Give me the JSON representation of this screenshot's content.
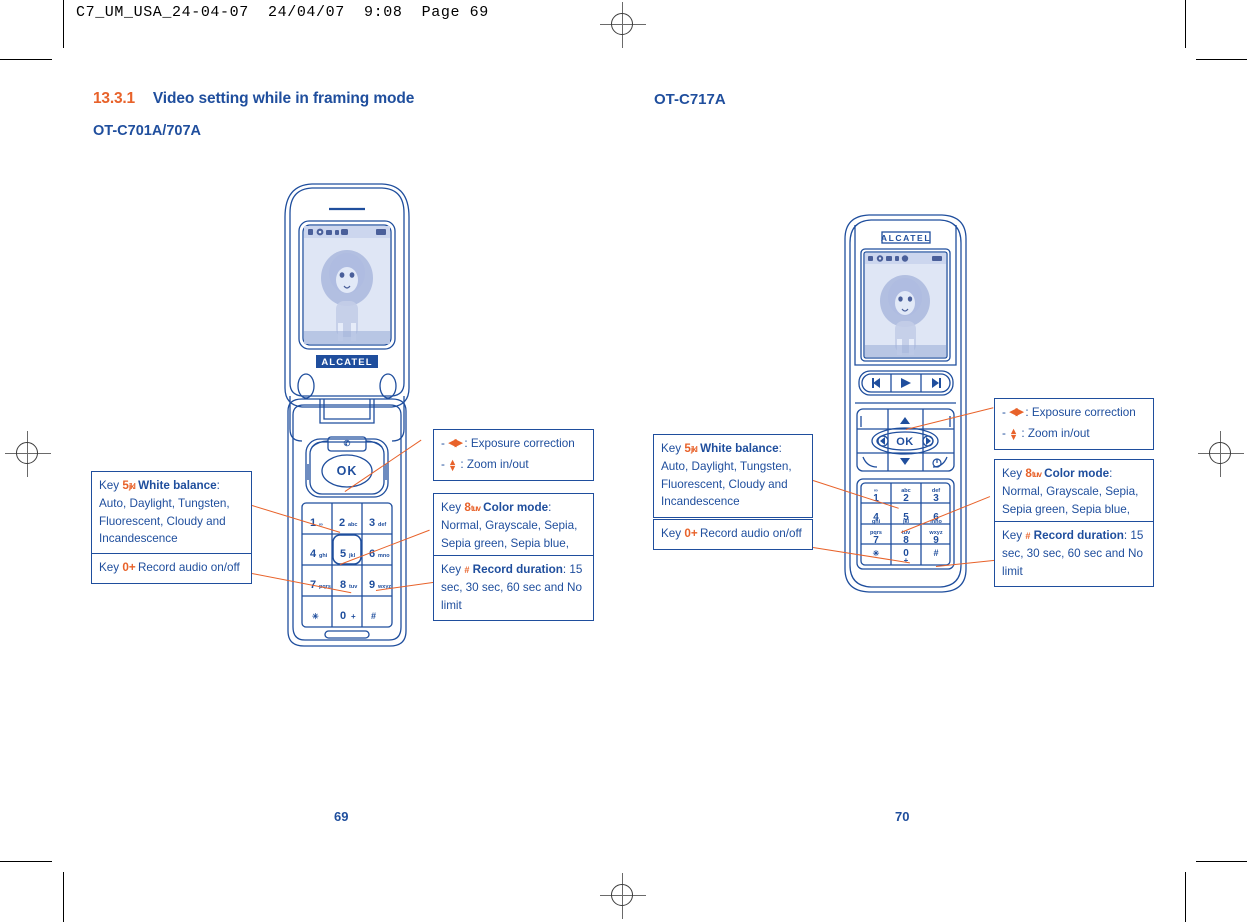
{
  "document": {
    "slug": "C7_UM_USA_24-04-07  24/04/07  9:08  Page 69",
    "colors": {
      "blue": "#1F4E9D",
      "orange": "#E8622A",
      "black": "#000000"
    }
  },
  "left_page": {
    "number": "69",
    "heading": {
      "number": "13.3.1",
      "title": "Video setting while in framing mode"
    },
    "subheading": "OT-C701A/707A",
    "phone": {
      "model": "OT-C701A/707A",
      "brand": "ALCATEL",
      "screen_subject": "lion photo",
      "ok_key": "OK",
      "keys": [
        {
          "digit": "1",
          "letters": ""
        },
        {
          "digit": "2",
          "letters": "abc"
        },
        {
          "digit": "3",
          "letters": "def"
        },
        {
          "digit": "4",
          "letters": "ghi"
        },
        {
          "digit": "5",
          "letters": "jkl"
        },
        {
          "digit": "6",
          "letters": "mno"
        },
        {
          "digit": "7",
          "letters": "pqrs"
        },
        {
          "digit": "8",
          "letters": "tuv"
        },
        {
          "digit": "9",
          "letters": "wxyz"
        },
        {
          "digit": "*",
          "letters": ""
        },
        {
          "digit": "0",
          "letters": "+"
        },
        {
          "digit": "#",
          "letters": ""
        }
      ]
    },
    "callouts": [
      {
        "id": "white-balance",
        "key_label": "Key",
        "key_code": "5",
        "key_glyph": "jkl",
        "term": "White balance",
        "body": ": Auto, Daylight, Tungsten, Fluorescent, Cloudy and Incandescence"
      },
      {
        "id": "record-audio",
        "key_label": "Key",
        "key_code": "0",
        "key_glyph": "+",
        "term": "",
        "body": "Record audio on/off"
      },
      {
        "id": "exposure-zoom",
        "line1_text": ": Exposure correction",
        "line2_text": ": Zoom in/out"
      },
      {
        "id": "color-mode",
        "key_label": "Key",
        "key_code": "8",
        "key_glyph": "tuv",
        "term": "Color mode",
        "body": ": Normal, Grayscale, Sepia, Sepia green, Sepia blue, etc."
      },
      {
        "id": "record-duration",
        "key_label": "Key",
        "key_code": "#",
        "key_glyph": "",
        "term": "Record duration",
        "body": ": 15 sec, 30 sec, 60 sec and No limit"
      }
    ]
  },
  "right_page": {
    "number": "70",
    "heading": "OT-C717A",
    "phone": {
      "model": "OT-C717A",
      "brand": "ALCATEL",
      "screen_subject": "lion photo",
      "ok_key": "OK",
      "media_buttons": [
        "previous",
        "play",
        "next"
      ],
      "keys": [
        {
          "digit": "1",
          "letters": ""
        },
        {
          "digit": "2",
          "letters": "abc"
        },
        {
          "digit": "3",
          "letters": "def"
        },
        {
          "digit": "4",
          "letters": "ghi"
        },
        {
          "digit": "5",
          "letters": "jkl"
        },
        {
          "digit": "6",
          "letters": "mno"
        },
        {
          "digit": "7",
          "letters": "pqrs"
        },
        {
          "digit": "8",
          "letters": "tuv"
        },
        {
          "digit": "9",
          "letters": "wxyz"
        },
        {
          "digit": "*",
          "letters": ""
        },
        {
          "digit": "0",
          "letters": "+"
        },
        {
          "digit": "#",
          "letters": ""
        }
      ]
    },
    "callouts": [
      {
        "id": "white-balance",
        "key_label": "Key",
        "key_code": "5",
        "key_glyph": "jkl",
        "term": "White balance",
        "body": ": Auto, Daylight, Tungsten, Fluorescent, Cloudy and Incandescence"
      },
      {
        "id": "record-audio",
        "key_label": "Key",
        "key_code": "0",
        "key_glyph": "+",
        "term": "",
        "body": "Record audio on/off"
      },
      {
        "id": "exposure-zoom",
        "line1_text": ": Exposure correction",
        "line2_text": ": Zoom in/out"
      },
      {
        "id": "color-mode",
        "key_label": "Key",
        "key_code": "8",
        "key_glyph": "tuv",
        "term": "Color mode",
        "body": ": Normal, Grayscale, Sepia, Sepia green, Sepia blue, etc."
      },
      {
        "id": "record-duration",
        "key_label": "Key",
        "key_code": "#",
        "key_glyph": "",
        "term": "Record duration",
        "body": ": 15 sec, 30 sec, 60 sec and No limit"
      }
    ]
  }
}
